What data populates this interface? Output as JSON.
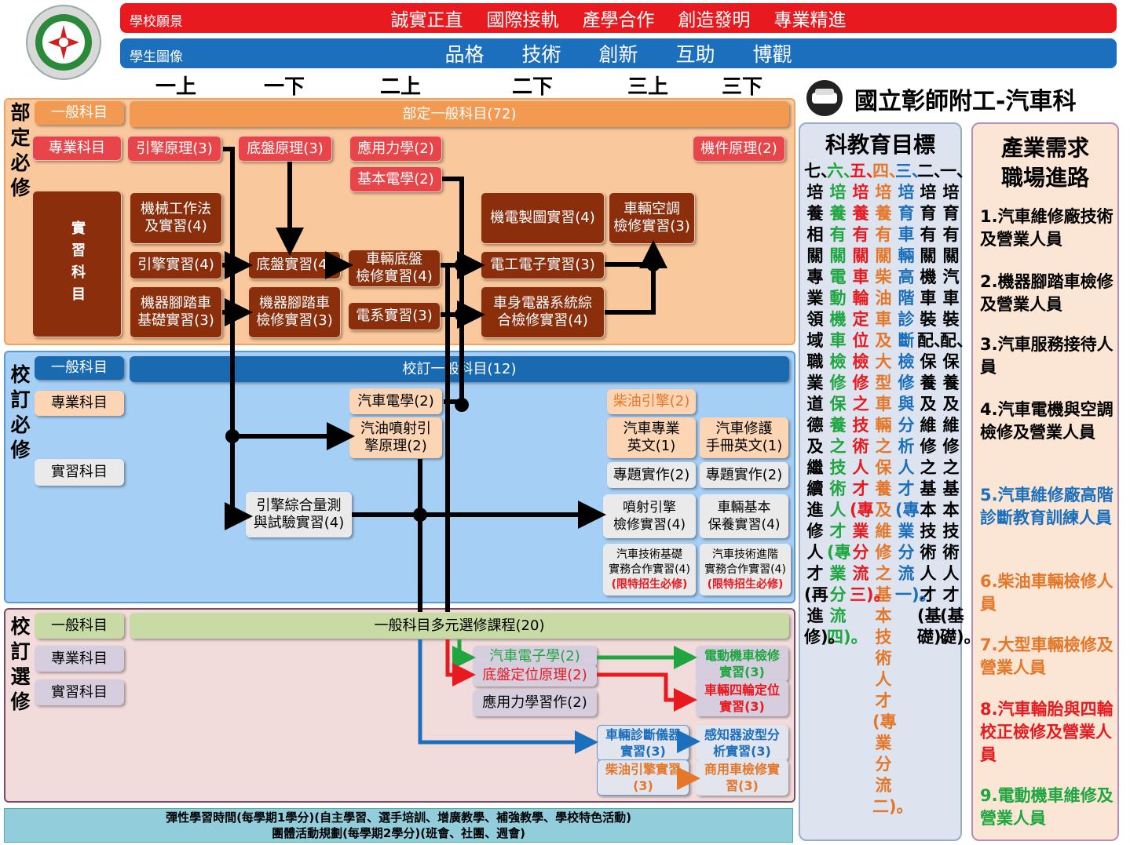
{
  "header": {
    "vision_label": "學校願景",
    "vision_values": [
      "誠實正直",
      "國際接軌",
      "產學合作",
      "創造發明",
      "專業精進"
    ],
    "portrait_label": "學生圖像",
    "portrait_values": [
      "品格",
      "技術",
      "創新",
      "互助",
      "博觀"
    ],
    "colors": {
      "vision": "#e8191f",
      "portrait": "#1b6fbd"
    }
  },
  "semesters": [
    "一上",
    "一下",
    "二上",
    "二下",
    "三上",
    "三下"
  ],
  "logo_text": "國立彰師附工-汽車科",
  "sections": {
    "required": {
      "title": "部定必修",
      "general_label": "一般科目",
      "general_bar": "部定一般科目(72)",
      "major_label": "專業科目",
      "practice_label": "實習科目",
      "major_courses": [
        "引擎原理(3)",
        "底盤原理(3)",
        "應用力學(2)",
        "基本電學(2)",
        "機件原理(2)"
      ],
      "practice_courses": {
        "machine": [
          "機械工作法",
          "及實習(4)"
        ],
        "engine_lab": "引擎實習(4)",
        "bike_basic": [
          "機器腳踏車",
          "基礎實習(3)"
        ],
        "chassis_lab": "底盤實習(4)",
        "bike_repair": [
          "機器腳踏車",
          "檢修實習(3)"
        ],
        "vehicle_chassis": [
          "車輛底盤",
          "檢修實習(4)"
        ],
        "electrical": "電系實習(3)",
        "mech_drawing": "機電製圖實習(4)",
        "ac": [
          "車輛空調",
          "檢修實習(3)"
        ],
        "electronics": "電工電子實習(3)",
        "body_electric": [
          "車身電器系統綜",
          "合檢修實習(4)"
        ]
      }
    },
    "school_required": {
      "title": "校訂必修",
      "general_label": "一般科目",
      "general_bar": "校訂一般科目(12)",
      "major_label": "專業科目",
      "practice_label": "實習科目",
      "courses": {
        "auto_electric": "汽車電學(2)",
        "gas_injection": [
          "汽油噴射引",
          "擎原理(2)"
        ],
        "diesel": "柴油引擎(2)",
        "auto_english": [
          "汽車專業",
          "英文(1)"
        ],
        "manual_english": [
          "汽車修護",
          "手冊英文(1)"
        ],
        "project1": "專題實作(2)",
        "project2": "專題實作(2)",
        "engine_measure": [
          "引擎綜合量測",
          "與試驗實習(4)"
        ],
        "injection_engine": [
          "噴射引擎",
          "檢修實習(4)"
        ],
        "vehicle_maint": [
          "車輛基本",
          "保養實習(4)"
        ],
        "coop_basic": [
          "汽車技術基礎",
          "實務合作實習(4)",
          "(限特招生必修)"
        ],
        "coop_adv": [
          "汽車技術進階",
          "實務合作實習(4)",
          "(限特招生必修)"
        ]
      }
    },
    "elective": {
      "title": "校訂選修",
      "general_label": "一般科目",
      "general_bar": "一般科目多元選修課程(20)",
      "major_label": "專業科目",
      "practice_label": "實習科目",
      "courses": {
        "auto_electronics": "汽車電子學(2)",
        "alignment": "底盤定位原理(2)",
        "applied_mech": "應用力學習作(2)",
        "ev_lab": [
          "電動機車檢修",
          "實習(3)"
        ],
        "wheel_align": [
          "車輛四輪定位",
          "實習(3)"
        ],
        "diag_lab": [
          "車輛診斷儀器",
          "實習(3)"
        ],
        "diesel_lab": [
          "柴油引擎實習",
          "(3)"
        ],
        "sensor_lab": [
          "感知器波型分",
          "析實習(3)"
        ],
        "commercial_lab": [
          "商用車檢修實",
          "習(3)"
        ]
      }
    }
  },
  "footer": {
    "line1": "彈性學習時間(每學期1學分)(自主學習、選手培訓、增廣教學、補強教學、學校特色活動)",
    "line2": "團體活動規劃(每學期2學分)(班會、社團、週會)"
  },
  "goals": {
    "title": "科教育目標",
    "items": [
      "一、培育有關汽車裝配、保養及維修之基本技術人才(基礎)。",
      "二、培育有關機車裝配、保養及維修之基本技術人才(基礎)。",
      "三、培育車輛高階診斷檢修與分析人才(專業分流一)。",
      "四、培養有關柴油車及大型車輛之保養及維修之基本技術人才(專業分流二)。",
      "五、培養有關車輪定位檢修之技術人才(專業分流三)。",
      "六、培養有關電動機車檢修保養之技術人才(專業分流四)。",
      "七、培養相關專業領域職業道德及繼續進修人才(再進修)。"
    ],
    "colors": [
      "#000000",
      "#000000",
      "#1b6fbd",
      "#e4772a",
      "#e8191f",
      "#1fa640",
      "#000000"
    ]
  },
  "industry": {
    "title": [
      "產業需求",
      "職場進路"
    ],
    "items": [
      "1.汽車維修廠技術及營業人員",
      "2.機器腳踏車檢修及營業人員",
      "3.汽車服務接待人員",
      "4.汽車電機與空調檢修及營業人員",
      "5.汽車維修廠高階診斷教育訓練人員",
      "6.柴油車輛檢修人員",
      "7.大型車輛檢修及營業人員",
      "8.汽車輪胎與四輪校正檢修及營業人員",
      "9.電動機車維修及營業人員"
    ],
    "colors": [
      "#000000",
      "#000000",
      "#000000",
      "#000000",
      "#1b6fbd",
      "#e4772a",
      "#e4772a",
      "#e8191f",
      "#1fa640"
    ]
  }
}
